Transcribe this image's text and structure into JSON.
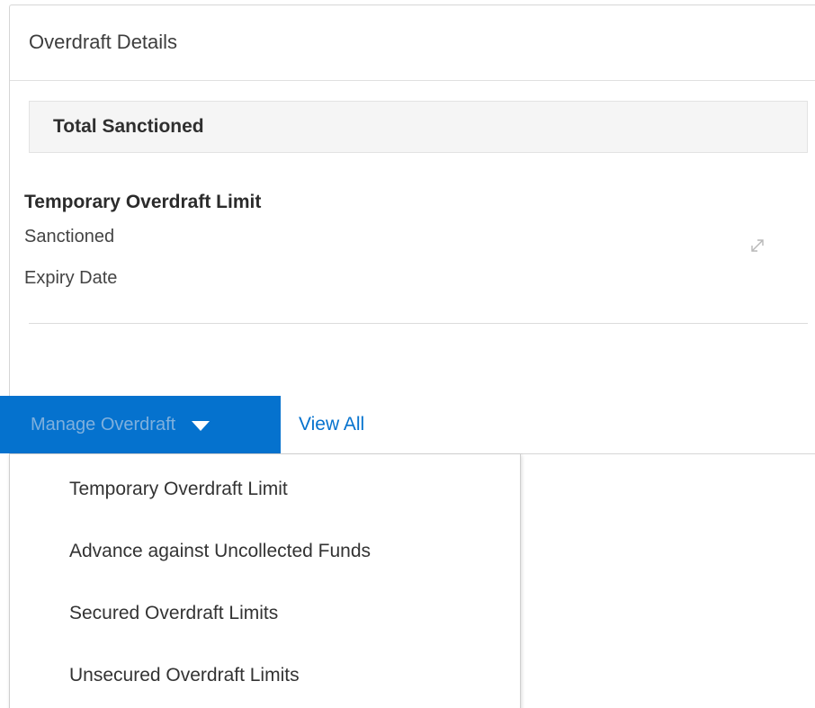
{
  "card": {
    "title": "Overdraft Details"
  },
  "section": {
    "label": "Total Sanctioned"
  },
  "overdraft": {
    "title": "Temporary Overdraft Limit",
    "sanctioned_label": "Sanctioned",
    "expiry_label": "Expiry Date",
    "expand_icon": "expand-arrows-icon"
  },
  "actions": {
    "manage_label": "Manage Overdraft",
    "view_all_label": "View All"
  },
  "menu": {
    "items": [
      {
        "label": "Temporary Overdraft Limit"
      },
      {
        "label": "Advance against Uncollected Funds"
      },
      {
        "label": "Secured Overdraft Limits"
      },
      {
        "label": "Unsecured Overdraft Limits"
      }
    ]
  },
  "colors": {
    "primary": "#0572ce",
    "section_bg": "#f5f5f5"
  }
}
